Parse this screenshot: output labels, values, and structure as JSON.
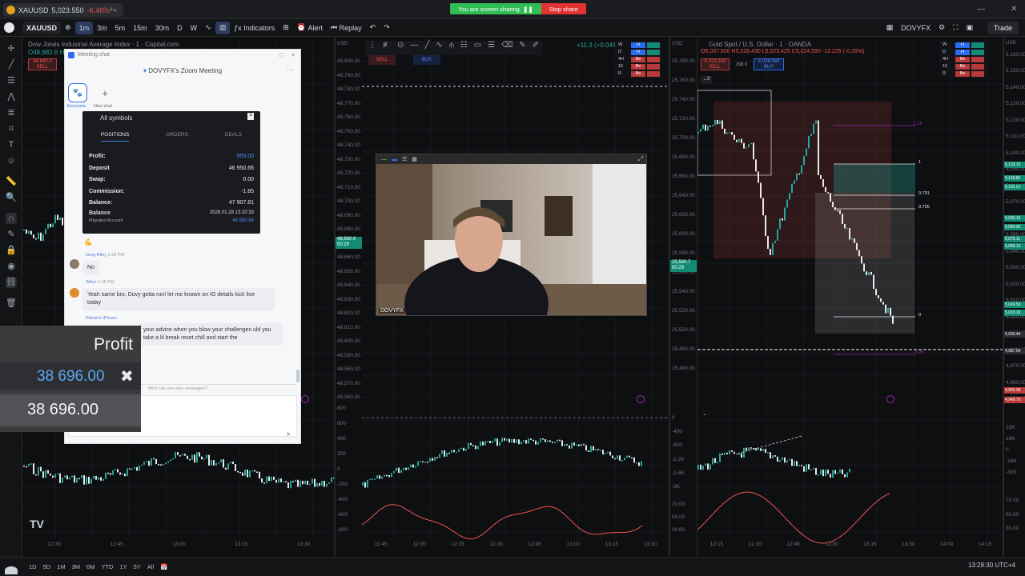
{
  "tab": {
    "symbol": "XAUUSD",
    "price": "5,023.550",
    "change": "-6.46%"
  },
  "screen_share": {
    "status": "You are screen sharing",
    "stop_label": "Stop share"
  },
  "toolbar": {
    "symbol": "XAUUSD",
    "intervals": [
      "1m",
      "3m",
      "5m",
      "15m",
      "30m",
      "D",
      "W"
    ],
    "selected_interval": "1m",
    "indicators_label": "Indicators",
    "alert_label": "Alert",
    "replay_label": "Replay",
    "account_label": "DOVYFX",
    "trade_label": "Trade"
  },
  "pane1": {
    "title": "Dow Jones Industrial Average Index · 1 · Capital.com",
    "sub": "O48,682.6 H48,",
    "sell_price": "48,680.0",
    "sell_label": "SELL",
    "currency": "USD",
    "price_tag": "48,680.0",
    "price_tag_sub": "00:29",
    "price_levels": [
      "48,800.00",
      "48,790.00",
      "48,780.00",
      "48,770.00",
      "48,760.00",
      "48,750.00",
      "48,740.00",
      "48,730.00",
      "48,720.00",
      "48,710.00",
      "48,700.00",
      "48,690.00",
      "48,680.00",
      "48,670.00",
      "48,660.00",
      "48,650.00",
      "48,640.00",
      "48,630.00",
      "48,620.00",
      "48,610.00",
      "48,600.00",
      "48,590.00",
      "48,580.00",
      "48,570.00",
      "48,560.00"
    ],
    "osc_levels": [
      "800",
      "600",
      "400",
      "200",
      "0",
      "-200",
      "-400",
      "-600",
      "-800"
    ],
    "time_labels": [
      "12:30",
      "12:45",
      "13:00",
      "13:15",
      "13:30"
    ]
  },
  "pane2": {
    "delta": "+11.3 (+0.04%)",
    "buy_label": "BUY",
    "sell_label": "SELL",
    "currency": "USD",
    "price_tag": "25,580.7",
    "price_tag_sub": "00:29",
    "price_levels": [
      "25,780.00",
      "25,760.00",
      "25,740.00",
      "25,720.00",
      "25,700.00",
      "25,680.00",
      "25,660.00",
      "25,640.00",
      "25,620.00",
      "25,600.00",
      "25,580.00",
      "25,560.00",
      "25,540.00",
      "25,520.00",
      "25,500.00",
      "25,480.00",
      "25,460.00"
    ],
    "osc_levels": [
      "0",
      "-400",
      "-800",
      "-1.2K",
      "-1.6K",
      "-2K"
    ],
    "rsi_levels": [
      "70.00",
      "50.00",
      "30.00"
    ],
    "time_labels": [
      "11:45",
      "12:00",
      "12:15",
      "12:30",
      "12:45",
      "13:00",
      "13:15",
      "13:30"
    ]
  },
  "pane3": {
    "title": "Gold Spot / U.S. Dollar · 1 · OANDA",
    "sub": "O5,037.920 H5,028.430 L5,023.425 C5,024.590 -13.225 (-0.26%)",
    "sell_price": "5,023.100",
    "sell_label": "SELL",
    "spread": "298.0",
    "buy_price": "5,026.080",
    "buy_label": "BUY",
    "count": "3",
    "currency": "USD",
    "fib_levels": [
      {
        "label": "1.25"
      },
      {
        "label": "1"
      },
      {
        "label": "0.791"
      },
      {
        "label": "0.705"
      },
      {
        "label": "0"
      },
      {
        "label": "-0.25"
      }
    ],
    "price_levels": [
      "5,160.000",
      "5,150.000",
      "5,140.000",
      "5,130.000",
      "5,120.000",
      "5,110.000",
      "5,100.000",
      "5,090.000",
      "5,080.000",
      "5,070.000",
      "5,060.000",
      "5,050.000",
      "5,040.000",
      "5,030.000",
      "5,020.000",
      "5,010.000",
      "5,000.000",
      "4,990.000",
      "4,980.000",
      "4,970.000",
      "4,960.000",
      "4,950.000"
    ],
    "price_tags": [
      "5,133.15",
      "5,118.80",
      "5,115.14",
      "5,090.16",
      "5,084.95",
      "5,075.11",
      "5,069.12",
      "5,024.59",
      "5,019.10",
      "5,000.44",
      "4,987.54",
      "4,955.98",
      "4,949.70"
    ],
    "osc_levels": [
      "32K",
      "16K",
      "0",
      "-16K",
      "-32K"
    ],
    "rsi_levels": [
      "70.00",
      "50.00",
      "30.00"
    ],
    "time_labels": [
      "12:15",
      "12:30",
      "12:45",
      "13:00",
      "13:15",
      "13:30",
      "14:00",
      "14:15"
    ]
  },
  "mtf_table": {
    "rows": [
      "W",
      "D",
      "4H",
      "15",
      "R"
    ],
    "status": [
      "H",
      "H",
      "Be",
      "Be",
      "Be"
    ]
  },
  "meeting": {
    "header": "Meeting chat",
    "title": "DOVYFX's Zoom Meeting",
    "tab_everyone": "Everyone",
    "tab_new": "New chat",
    "placeholder": "Who can see your messages?"
  },
  "mt_positions": {
    "header": "All symbols",
    "badge": "3",
    "tabs": [
      "POSITIONS",
      "ORDERS",
      "DEALS"
    ],
    "rows": [
      {
        "label": "Profit:",
        "value": "959.00",
        "accent": true
      },
      {
        "label": "Deposit",
        "value": "46 950.66",
        "accent": false
      },
      {
        "label": "Swap:",
        "value": "0.00",
        "accent": false
      },
      {
        "label": "Commission:",
        "value": "-1.85",
        "accent": false
      },
      {
        "label": "Balance:",
        "value": "47 907.81",
        "accent": false
      }
    ],
    "footer_label": "Balance",
    "footer_sub": "Migrated Account",
    "footer_date": "2026.01.28 13:20:33",
    "footer_value": "46 950.66"
  },
  "chat": [
    {
      "name": "Greg Riley",
      "time": "1:23 PM",
      "text": "No"
    },
    {
      "name": "Wilco",
      "time": "1:25 PM",
      "text": "Yeah same bro, Dovy gotta run! let me known on IG details kick live today"
    },
    {
      "name": "Rohan's iPhone",
      "time": "",
      "text": "your advice when you blow your challenges uld you take a lil break reset chill and start the"
    }
  ],
  "profit_panel": {
    "label": "Profit",
    "value1": "38 696.00",
    "value2": "38 696.00"
  },
  "webcam": {
    "name": "DOVYFX"
  },
  "bottombar": {
    "ranges": [
      "1D",
      "5D",
      "1M",
      "3M",
      "6M",
      "YTD",
      "1Y",
      "5Y",
      "All"
    ],
    "clock": "13:28:30 UTC+4"
  },
  "colors": {
    "up": "#26a69a",
    "down": "#ef5350",
    "accent": "#2962ff"
  }
}
